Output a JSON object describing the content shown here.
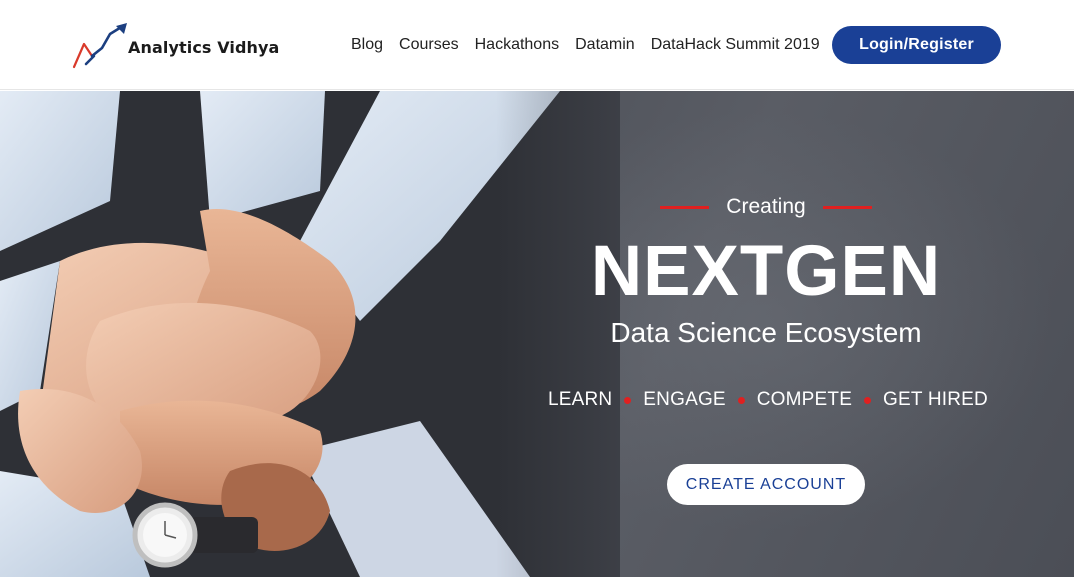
{
  "header": {
    "logo_text": "Analytics Vidhya",
    "nav": [
      {
        "label": "Blog"
      },
      {
        "label": "Courses"
      },
      {
        "label": "Hackathons"
      },
      {
        "label": "Datamin"
      },
      {
        "label": "DataHack Summit 2019"
      }
    ],
    "login_label": "Login/Register"
  },
  "hero": {
    "kicker": "Creating",
    "headline": "NEXTGEN",
    "subtitle": "Data Science Ecosystem",
    "pillars": [
      "LEARN",
      "ENGAGE",
      "COMPETE",
      "GET HIRED"
    ],
    "cta_label": "CREATE ACCOUNT"
  },
  "colors": {
    "brand_blue": "#1a4096",
    "accent_red": "#e02020",
    "hero_bg": "#4d5058"
  }
}
